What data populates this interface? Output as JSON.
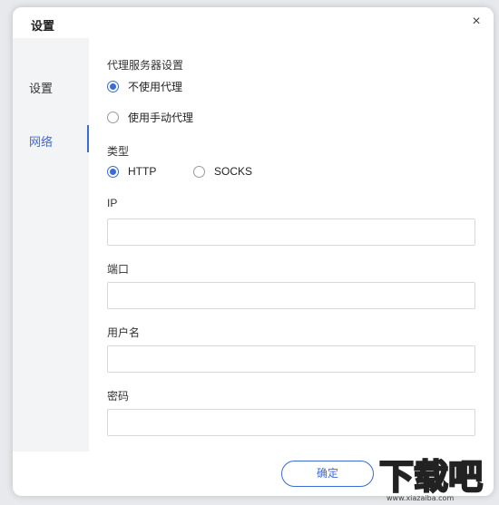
{
  "dialog": {
    "title": "设置",
    "close_symbol": "×"
  },
  "sidebar": {
    "items": [
      {
        "label": "设置",
        "active": false
      },
      {
        "label": "网络",
        "active": true
      }
    ]
  },
  "proxy": {
    "section_label": "代理服务器设置",
    "options": [
      {
        "label": "不使用代理",
        "checked": true
      },
      {
        "label": "使用手动代理",
        "checked": false
      }
    ]
  },
  "type": {
    "label": "类型",
    "options": [
      {
        "label": "HTTP",
        "checked": true
      },
      {
        "label": "SOCKS",
        "checked": false
      }
    ]
  },
  "fields": {
    "ip": {
      "label": "IP",
      "value": ""
    },
    "port": {
      "label": "端口",
      "value": ""
    },
    "username": {
      "label": "用户名",
      "value": ""
    },
    "password": {
      "label": "密码",
      "value": ""
    }
  },
  "footer": {
    "confirm_label": "确定"
  },
  "watermark": {
    "text": "下载吧",
    "url_text": "www.xiazaiba.com"
  },
  "colors": {
    "accent": "#3b6bd6",
    "sidebar_bg": "#f3f4f6",
    "border": "#d6d8dc"
  }
}
